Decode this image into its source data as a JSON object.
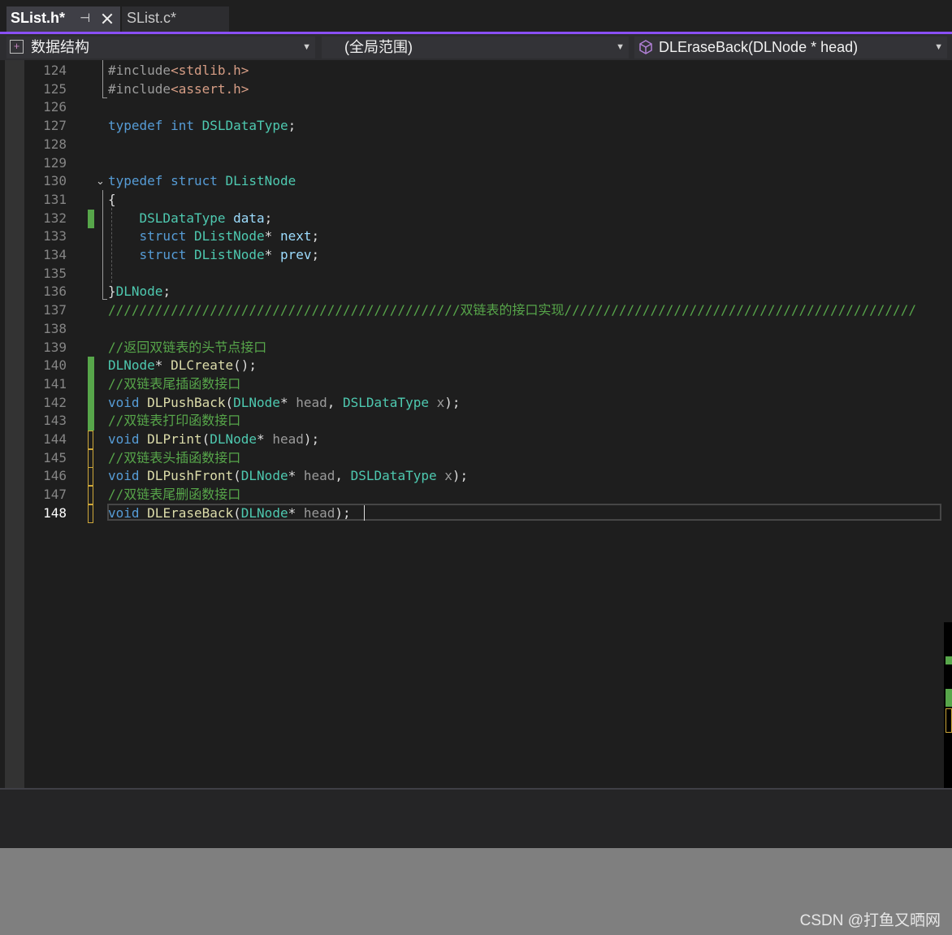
{
  "tabs": {
    "active": "SList.h*",
    "inactive": "SList.c*"
  },
  "navigation": {
    "project": "数据结构",
    "scope": "(全局范围)",
    "member": "DLEraseBack(DLNode * head)"
  },
  "editor": {
    "current_line": 148,
    "lines": [
      {
        "n": 124,
        "change": "none",
        "tokens": [
          [
            "pp",
            "#include"
          ],
          [
            "str",
            "<stdlib.h>"
          ]
        ]
      },
      {
        "n": 125,
        "change": "none",
        "tokens": [
          [
            "pp",
            "#include"
          ],
          [
            "str",
            "<assert.h>"
          ]
        ]
      },
      {
        "n": 126,
        "change": "none",
        "tokens": []
      },
      {
        "n": 127,
        "change": "none",
        "tokens": [
          [
            "kw",
            "typedef"
          ],
          [
            "pl",
            " "
          ],
          [
            "kw",
            "int"
          ],
          [
            "pl",
            " "
          ],
          [
            "ty",
            "DSLDataType"
          ],
          [
            "pl",
            ";"
          ]
        ]
      },
      {
        "n": 128,
        "change": "none",
        "tokens": []
      },
      {
        "n": 129,
        "change": "none",
        "tokens": []
      },
      {
        "n": 130,
        "change": "none",
        "fold": true,
        "tokens": [
          [
            "kw",
            "typedef"
          ],
          [
            "pl",
            " "
          ],
          [
            "kw",
            "struct"
          ],
          [
            "pl",
            " "
          ],
          [
            "ty",
            "DListNode"
          ]
        ]
      },
      {
        "n": 131,
        "change": "none",
        "tokens": [
          [
            "pl",
            "{"
          ]
        ]
      },
      {
        "n": 132,
        "change": "saved",
        "tokens": [
          [
            "pl",
            "    "
          ],
          [
            "ty",
            "DSLDataType"
          ],
          [
            "pl",
            " "
          ],
          [
            "var",
            "data"
          ],
          [
            "pl",
            ";"
          ]
        ]
      },
      {
        "n": 133,
        "change": "none",
        "tokens": [
          [
            "pl",
            "    "
          ],
          [
            "kw",
            "struct"
          ],
          [
            "pl",
            " "
          ],
          [
            "ty",
            "DListNode"
          ],
          [
            "pl",
            "* "
          ],
          [
            "var",
            "next"
          ],
          [
            "pl",
            ";"
          ]
        ]
      },
      {
        "n": 134,
        "change": "none",
        "tokens": [
          [
            "pl",
            "    "
          ],
          [
            "kw",
            "struct"
          ],
          [
            "pl",
            " "
          ],
          [
            "ty",
            "DListNode"
          ],
          [
            "pl",
            "* "
          ],
          [
            "var",
            "prev"
          ],
          [
            "pl",
            ";"
          ]
        ]
      },
      {
        "n": 135,
        "change": "none",
        "tokens": []
      },
      {
        "n": 136,
        "change": "none",
        "tokens": [
          [
            "pl",
            "}"
          ],
          [
            "ty",
            "DLNode"
          ],
          [
            "pl",
            ";"
          ]
        ]
      },
      {
        "n": 137,
        "change": "none",
        "tokens": [
          [
            "cm",
            "/////////////////////////////////////////////双链表的接口实现/////////////////////////////////////////////"
          ]
        ]
      },
      {
        "n": 138,
        "change": "none",
        "tokens": []
      },
      {
        "n": 139,
        "change": "none",
        "tokens": [
          [
            "cm",
            "//返回双链表的头节点接口"
          ]
        ]
      },
      {
        "n": 140,
        "change": "saved",
        "tokens": [
          [
            "ty",
            "DLNode"
          ],
          [
            "pl",
            "* "
          ],
          [
            "fn",
            "DLCreate"
          ],
          [
            "pl",
            "();"
          ]
        ]
      },
      {
        "n": 141,
        "change": "saved",
        "tokens": [
          [
            "cm",
            "//双链表尾插函数接口"
          ]
        ]
      },
      {
        "n": 142,
        "change": "saved",
        "tokens": [
          [
            "kw",
            "void"
          ],
          [
            "pl",
            " "
          ],
          [
            "fn",
            "DLPushBack"
          ],
          [
            "pl",
            "("
          ],
          [
            "ty",
            "DLNode"
          ],
          [
            "pl",
            "* "
          ],
          [
            "par",
            "head"
          ],
          [
            "pl",
            ", "
          ],
          [
            "ty",
            "DSLDataType"
          ],
          [
            "pl",
            " "
          ],
          [
            "par",
            "x"
          ],
          [
            "pl",
            ");"
          ]
        ]
      },
      {
        "n": 143,
        "change": "saved",
        "tokens": [
          [
            "cm",
            "//双链表打印函数接口"
          ]
        ]
      },
      {
        "n": 144,
        "change": "unsaved",
        "tokens": [
          [
            "kw",
            "void"
          ],
          [
            "pl",
            " "
          ],
          [
            "fn",
            "DLPrint"
          ],
          [
            "pl",
            "("
          ],
          [
            "ty",
            "DLNode"
          ],
          [
            "pl",
            "* "
          ],
          [
            "par",
            "head"
          ],
          [
            "pl",
            ");"
          ]
        ]
      },
      {
        "n": 145,
        "change": "unsaved",
        "tokens": [
          [
            "cm",
            "//双链表头插函数接口"
          ]
        ]
      },
      {
        "n": 146,
        "change": "unsaved",
        "tokens": [
          [
            "kw",
            "void"
          ],
          [
            "pl",
            " "
          ],
          [
            "fn",
            "DLPushFront"
          ],
          [
            "pl",
            "("
          ],
          [
            "ty",
            "DLNode"
          ],
          [
            "pl",
            "* "
          ],
          [
            "par",
            "head"
          ],
          [
            "pl",
            ", "
          ],
          [
            "ty",
            "DSLDataType"
          ],
          [
            "pl",
            " "
          ],
          [
            "par",
            "x"
          ],
          [
            "pl",
            ");"
          ]
        ]
      },
      {
        "n": 147,
        "change": "unsaved",
        "tokens": [
          [
            "cm",
            "//双链表尾删函数接口"
          ]
        ]
      },
      {
        "n": 148,
        "change": "unsaved",
        "tokens": [
          [
            "kw",
            "void"
          ],
          [
            "pl",
            " "
          ],
          [
            "fn",
            "DLEraseBack"
          ],
          [
            "pl",
            "("
          ],
          [
            "ty",
            "DLNode"
          ],
          [
            "pl",
            "* "
          ],
          [
            "par",
            "head"
          ],
          [
            "pl",
            ");"
          ]
        ]
      }
    ]
  },
  "colors": {
    "keyword": "#569cd6",
    "type": "#4ec9b0",
    "function": "#dcdcaa",
    "comment": "#57a64a",
    "accent": "#8a4ff5"
  },
  "watermark": "CSDN @打鱼又晒网"
}
